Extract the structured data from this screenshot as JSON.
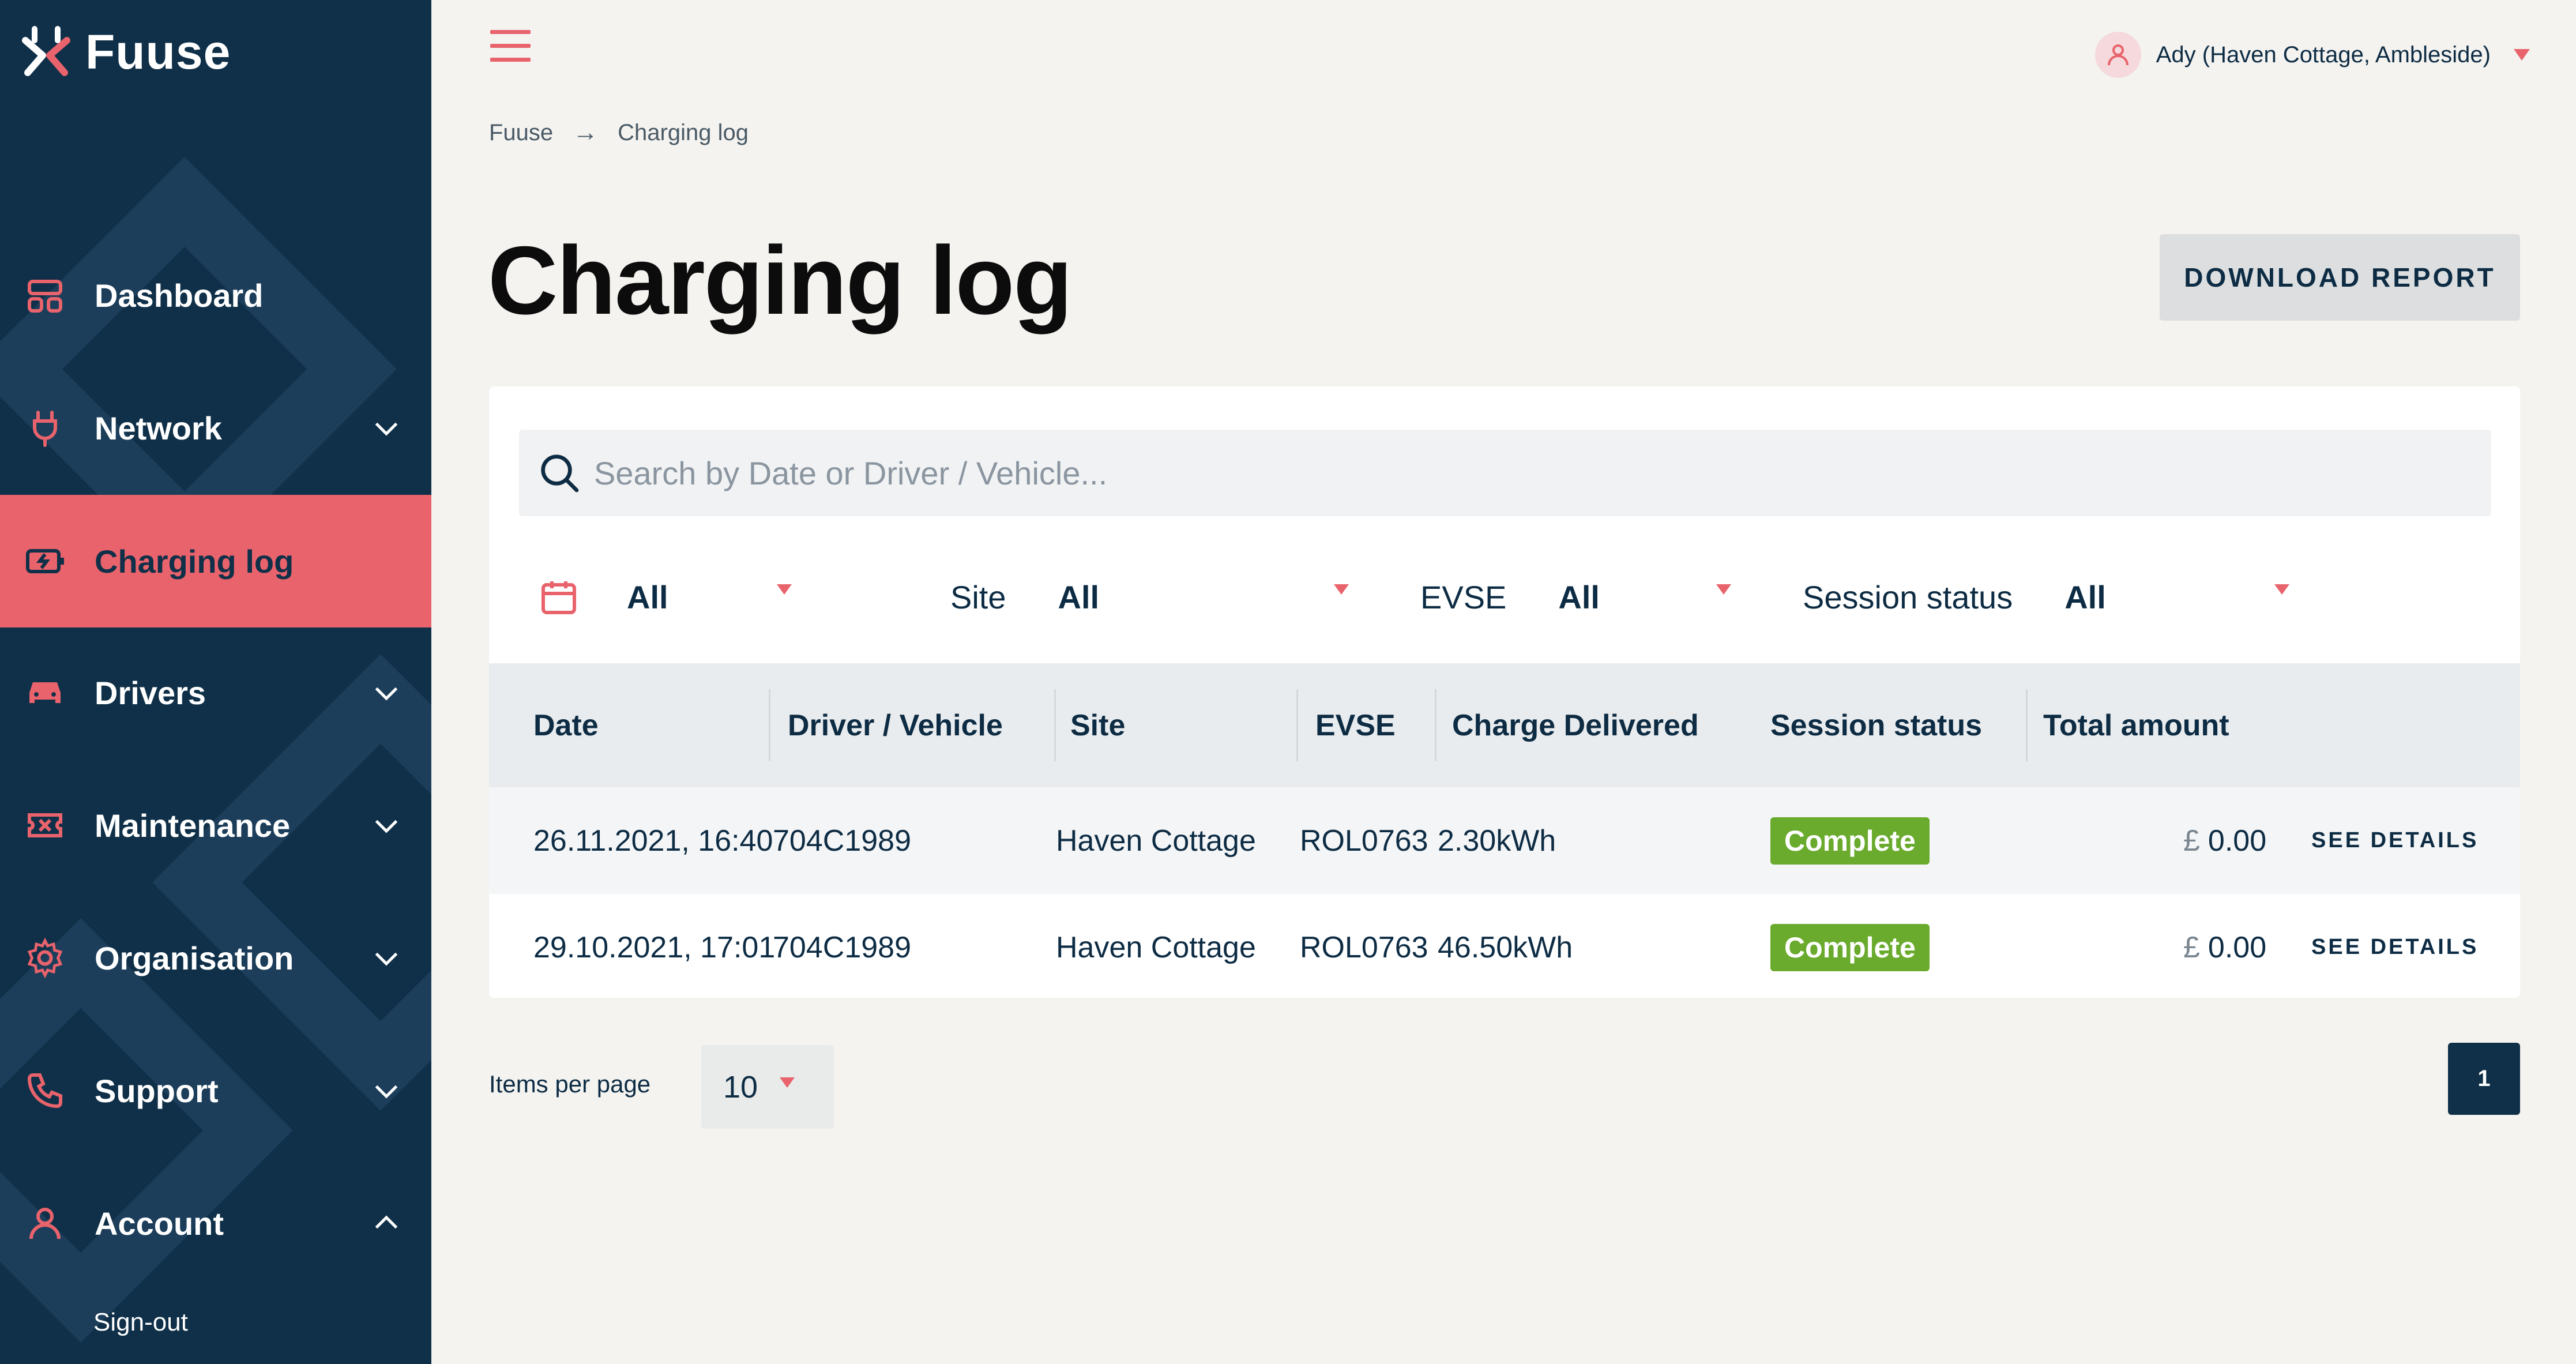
{
  "app": {
    "brand": "Fuuse"
  },
  "colors": {
    "sidebar": "#0f3048",
    "accent": "#e8636c",
    "status_complete": "#6aab2e",
    "background": "#f4f3f0"
  },
  "header": {
    "user": "Ady (Haven Cottage, Ambleside)",
    "menu_icon": "hamburger-icon",
    "user_icon": "user-icon"
  },
  "breadcrumb": {
    "root": "Fuuse",
    "current": "Charging log"
  },
  "page": {
    "title": "Charging log",
    "download_label": "DOWNLOAD REPORT"
  },
  "sidebar": {
    "items": [
      {
        "label": "Dashboard",
        "icon": "dashboard-icon",
        "chevron": ""
      },
      {
        "label": "Network",
        "icon": "plug-icon",
        "chevron": "down"
      },
      {
        "label": "Charging log",
        "icon": "battery-icon",
        "chevron": "",
        "active": true
      },
      {
        "label": "Drivers",
        "icon": "car-icon",
        "chevron": "down"
      },
      {
        "label": "Maintenance",
        "icon": "ticket-icon",
        "chevron": "down"
      },
      {
        "label": "Organisation",
        "icon": "gear-icon",
        "chevron": "down"
      },
      {
        "label": "Support",
        "icon": "phone-icon",
        "chevron": "down"
      },
      {
        "label": "Account",
        "icon": "user-icon",
        "chevron": "up"
      }
    ],
    "signout": "Sign-out"
  },
  "search": {
    "placeholder": "Search by Date or Driver / Vehicle..."
  },
  "filters": {
    "date": {
      "value": "All",
      "icon": "calendar-icon"
    },
    "site": {
      "label": "Site",
      "value": "All"
    },
    "evse": {
      "label": "EVSE",
      "value": "All"
    },
    "session_status": {
      "label": "Session status",
      "value": "All"
    }
  },
  "table": {
    "columns": [
      "Date",
      "Driver / Vehicle",
      "Site",
      "EVSE",
      "Charge Delivered",
      "Session status",
      "Total amount"
    ],
    "rows": [
      {
        "date": "26.11.2021, 16:40",
        "driver": "704C1989",
        "site": "Haven Cottage",
        "evse": "ROL0763",
        "charge": "2.30kWh",
        "status": "Complete",
        "currency": "£",
        "amount": "0.00",
        "action": "SEE DETAILS"
      },
      {
        "date": "29.10.2021, 17:01",
        "driver": "704C1989",
        "site": "Haven Cottage",
        "evse": "ROL0763",
        "charge": "46.50kWh",
        "status": "Complete",
        "currency": "£",
        "amount": "0.00",
        "action": "SEE DETAILS"
      }
    ]
  },
  "pagination": {
    "items_per_page_label": "Items per page",
    "items_per_page": "10",
    "page": "1"
  }
}
